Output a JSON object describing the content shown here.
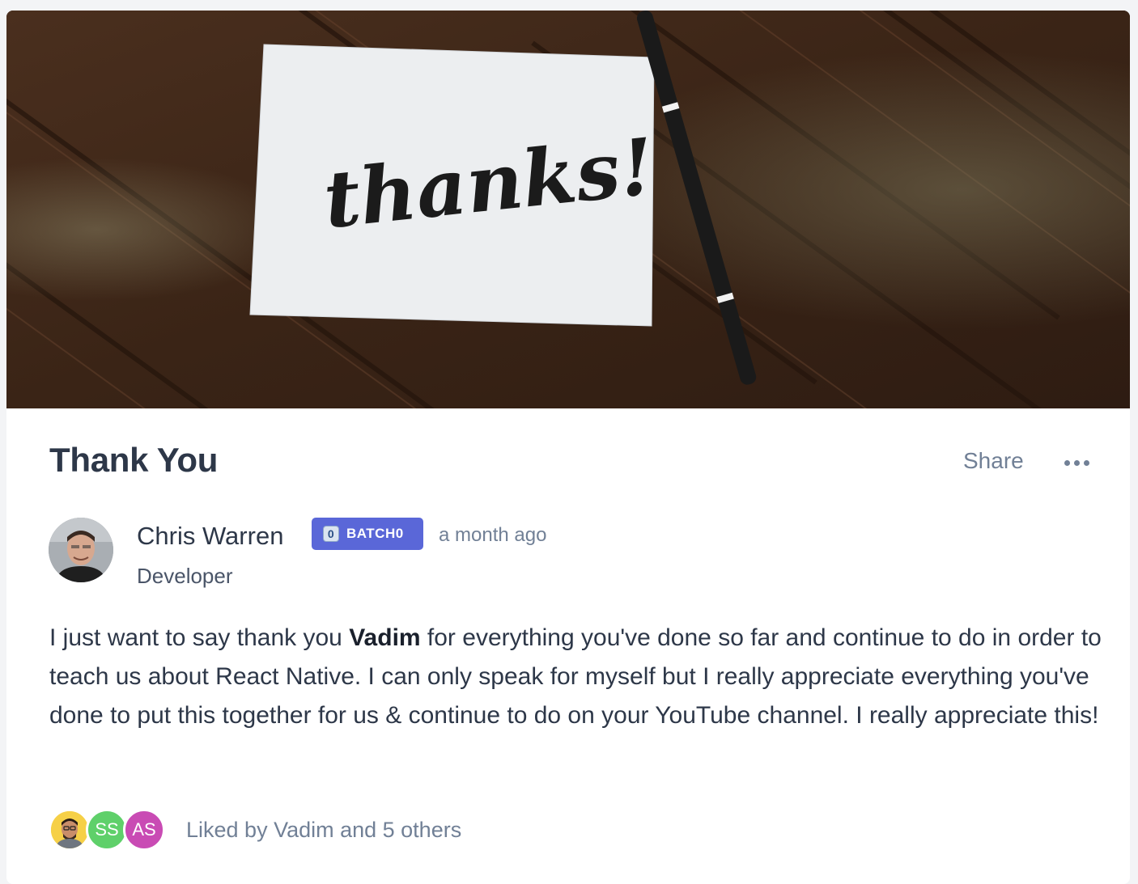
{
  "post": {
    "title": "Thank You",
    "share_label": "Share",
    "more_icon": "more-horizontal-icon",
    "cover_image": {
      "text": "thanks!"
    },
    "author": {
      "name": "Chris Warren",
      "role": "Developer",
      "badge_icon_glyph": "0",
      "badge_label": "BATCH0",
      "badge_color": "#5a67d8",
      "timestamp": "a month ago"
    },
    "body": {
      "before": "I just want to say thank you ",
      "mention": "Vadim",
      "after": " for everything you've done so far and continue to do in order to teach us about React Native. I can only speak for myself but I really appreciate everything you've done to put this together for us & continue to do on your YouTube channel. I really appreciate this!"
    },
    "likes": {
      "avatars": [
        {
          "initials": "",
          "color": "#f6d047"
        },
        {
          "initials": "SS",
          "color": "#5fd06a"
        },
        {
          "initials": "AS",
          "color": "#c94bb4"
        }
      ],
      "text": "Liked by Vadim and 5 others"
    }
  }
}
